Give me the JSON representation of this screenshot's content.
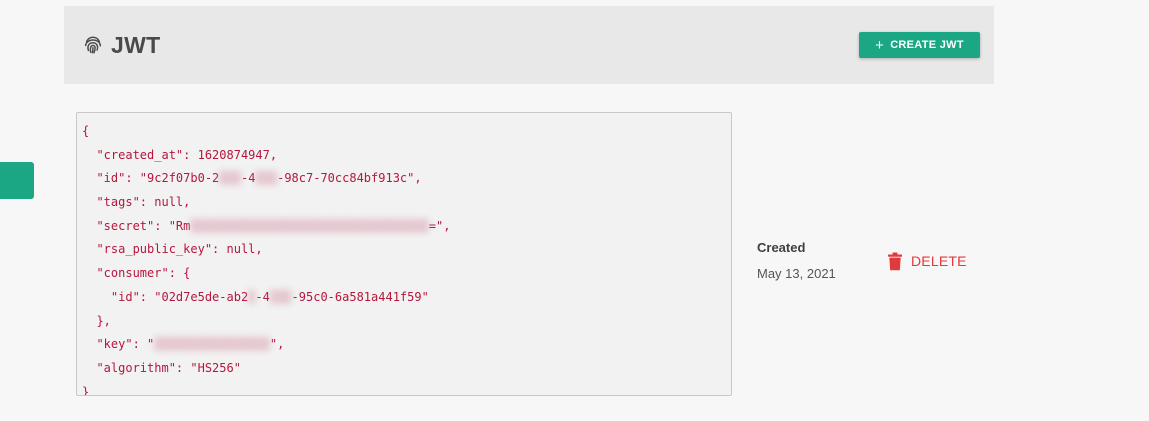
{
  "header": {
    "title": "JWT",
    "icon": "fingerprint-icon",
    "create_button_label": "CREATE JWT",
    "create_button_icon": "plus-icon"
  },
  "jwt": {
    "code_lines": [
      "{",
      "  \"created_at\": 1620874947,",
      "  \"id\": \"9c2f07b0-2▒▒▒-4▒▒▒-98c7-70cc84bf913c\",",
      "  \"tags\": null,",
      "  \"secret\": \"Rm▒▒▒▒▒▒▒▒▒▒▒▒▒▒▒▒▒▒▒▒▒▒▒▒▒▒▒▒▒▒▒▒▒=\",",
      "  \"rsa_public_key\": null,",
      "  \"consumer\": {",
      "    \"id\": \"02d7e5de-ab2▒-4▒▒▒-95c0-6a581a441f59\"",
      "  },",
      "  \"key\": \"▒▒▒▒▒▒▒▒▒▒▒▒▒▒▒▒\",",
      "  \"algorithm\": \"HS256\"",
      "}"
    ],
    "created_label": "Created",
    "created_date": "May 13, 2021",
    "delete_label": "DELETE",
    "delete_icon": "trash-icon"
  },
  "colors": {
    "accent": "#1ba783",
    "danger": "#e23a3a",
    "code_text": "#b5173d",
    "header_bg": "#e8e8e8",
    "page_bg": "#f7f7f7"
  }
}
